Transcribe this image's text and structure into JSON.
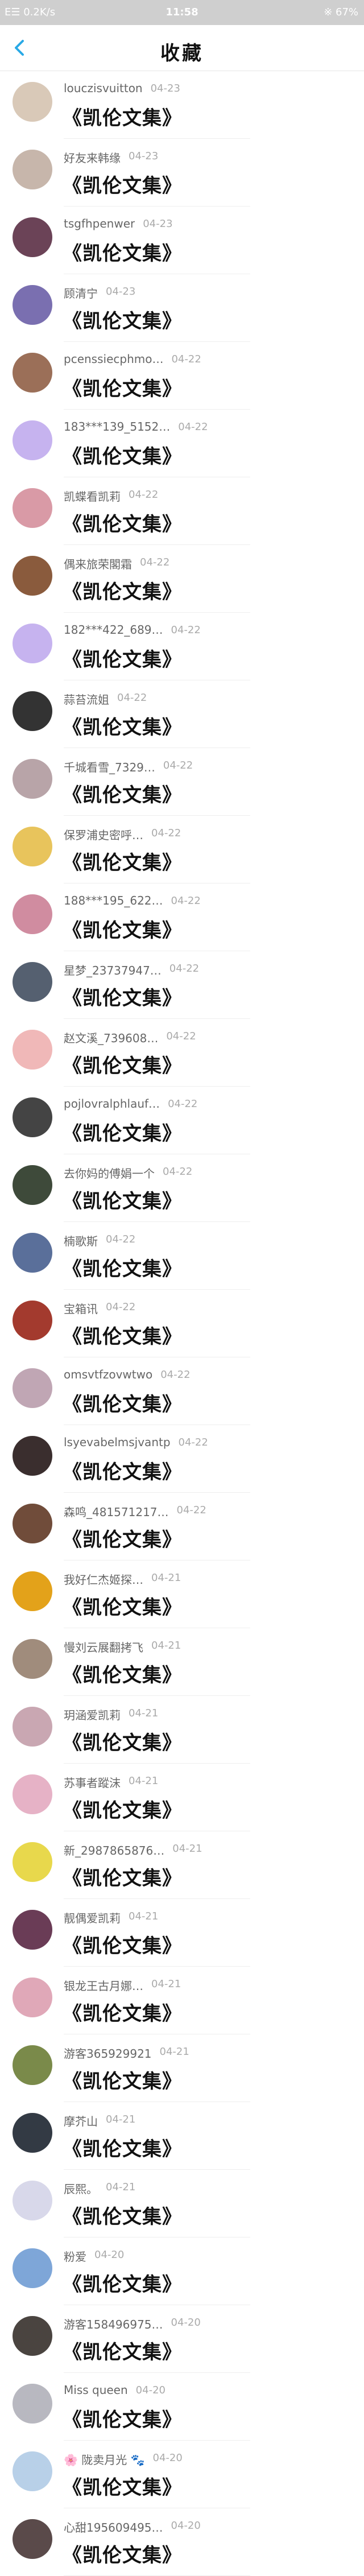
{
  "status_bar": {
    "left_text": "E☰ 0.2K/s",
    "time": "11:58",
    "right_text": "※ 67%"
  },
  "header": {
    "title": "收藏"
  },
  "items": [
    {
      "user": "louczisvuitton",
      "date": "04-23",
      "work": "《凯伦文集》",
      "avatar_color": "#d9c9b8"
    },
    {
      "user": "好友来韩缘",
      "date": "04-23",
      "work": "《凯伦文集》",
      "avatar_color": "#c7b6ab"
    },
    {
      "user": "tsgfhpenwer",
      "date": "04-23",
      "work": "《凯伦文集》",
      "avatar_color": "#6b4357"
    },
    {
      "user": "顾清宁",
      "date": "04-23",
      "work": "《凯伦文集》",
      "avatar_color": "#7a6fb0"
    },
    {
      "user": "pcenssiecphmo…",
      "date": "04-22",
      "work": "《凯伦文集》",
      "avatar_color": "#9b6f58"
    },
    {
      "user": "183***139_5152…",
      "date": "04-22",
      "work": "《凯伦文集》",
      "avatar_color": "#c6b3ef"
    },
    {
      "user": "凯蝶看凯莉",
      "date": "04-22",
      "work": "《凯伦文集》",
      "avatar_color": "#d99aa6"
    },
    {
      "user": "偶来旅荣閣霜",
      "date": "04-22",
      "work": "《凯伦文集》",
      "avatar_color": "#8a5b3d"
    },
    {
      "user": "182***422_689…",
      "date": "04-22",
      "work": "《凯伦文集》",
      "avatar_color": "#c6b3ef"
    },
    {
      "user": "蒜苔流姐",
      "date": "04-22",
      "work": "《凯伦文集》",
      "avatar_color": "#333333"
    },
    {
      "user": "千城看雪_7329…",
      "date": "04-22",
      "work": "《凯伦文集》",
      "avatar_color": "#b8a4a8"
    },
    {
      "user": "保罗浦史密呼…",
      "date": "04-22",
      "work": "《凯伦文集》",
      "avatar_color": "#e8c45c"
    },
    {
      "user": "188***195_622…",
      "date": "04-22",
      "work": "《凯伦文集》",
      "avatar_color": "#d08ca0"
    },
    {
      "user": "星梦_23737947…",
      "date": "04-22",
      "work": "《凯伦文集》",
      "avatar_color": "#556070"
    },
    {
      "user": "赵文溪_739608…",
      "date": "04-22",
      "work": "《凯伦文集》",
      "avatar_color": "#f0b8b8"
    },
    {
      "user": "pojlovralphlauf…",
      "date": "04-22",
      "work": "《凯伦文集》",
      "avatar_color": "#444444"
    },
    {
      "user": "去你妈的傅娟一个",
      "date": "04-22",
      "work": "《凯伦文集》",
      "avatar_color": "#3e4a3a"
    },
    {
      "user": "楠歌斯",
      "date": "04-22",
      "work": "《凯伦文集》",
      "avatar_color": "#5a6f9a"
    },
    {
      "user": "宝箱讯",
      "date": "04-22",
      "work": "《凯伦文集》",
      "avatar_color": "#a33a2e"
    },
    {
      "user": "omsvtfzovwtwo",
      "date": "04-22",
      "work": "《凯伦文集》",
      "avatar_color": "#c0a6b4"
    },
    {
      "user": "lsyevabelmsjvantp",
      "date": "04-22",
      "work": "《凯伦文集》",
      "avatar_color": "#3a2e2e"
    },
    {
      "user": "森鸣_481571217…",
      "date": "04-22",
      "work": "《凯伦文集》",
      "avatar_color": "#704c3a"
    },
    {
      "user": "我好仁杰姬探…",
      "date": "04-21",
      "work": "《凯伦文集》",
      "avatar_color": "#e3a21a"
    },
    {
      "user": "慢刘云展翻拷飞",
      "date": "04-21",
      "work": "《凯伦文集》",
      "avatar_color": "#a08c7c"
    },
    {
      "user": "玥涵爱凯莉",
      "date": "04-21",
      "work": "《凯伦文集》",
      "avatar_color": "#c9a7b2"
    },
    {
      "user": "苏事者蹤沫",
      "date": "04-21",
      "work": "《凯伦文集》",
      "avatar_color": "#e6b2c6"
    },
    {
      "user": "新_2987865876…",
      "date": "04-21",
      "work": "《凯伦文集》",
      "avatar_color": "#e8d84c"
    },
    {
      "user": "靓偶爱凯莉",
      "date": "04-21",
      "work": "《凯伦文集》",
      "avatar_color": "#6a3c56"
    },
    {
      "user": "银龙王古月娜…",
      "date": "04-21",
      "work": "《凯伦文集》",
      "avatar_color": "#e0a8b8"
    },
    {
      "user": "游客365929921",
      "date": "04-21",
      "work": "《凯伦文集》",
      "avatar_color": "#7a8a4a"
    },
    {
      "user": "摩芥山",
      "date": "04-21",
      "work": "《凯伦文集》",
      "avatar_color": "#333a44"
    },
    {
      "user": "辰熙。",
      "date": "04-21",
      "work": "《凯伦文集》",
      "avatar_color": "#d8d8ea"
    },
    {
      "user": "粉爱",
      "date": "04-20",
      "work": "《凯伦文集》",
      "avatar_color": "#7ea6d8"
    },
    {
      "user": "游客158496975…",
      "date": "04-20",
      "work": "《凯伦文集》",
      "avatar_color": "#4a4440"
    },
    {
      "user": "Miss queen",
      "date": "04-20",
      "work": "《凯伦文集》",
      "avatar_color": "#b8b8c0"
    },
    {
      "user": "🌸 陇卖月光 🐾",
      "date": "04-20",
      "work": "《凯伦文集》",
      "avatar_color": "#b8d0e8"
    },
    {
      "user": "心甜195609495…",
      "date": "04-20",
      "work": "《凯伦文集》",
      "avatar_color": "#5a4a4a"
    }
  ]
}
